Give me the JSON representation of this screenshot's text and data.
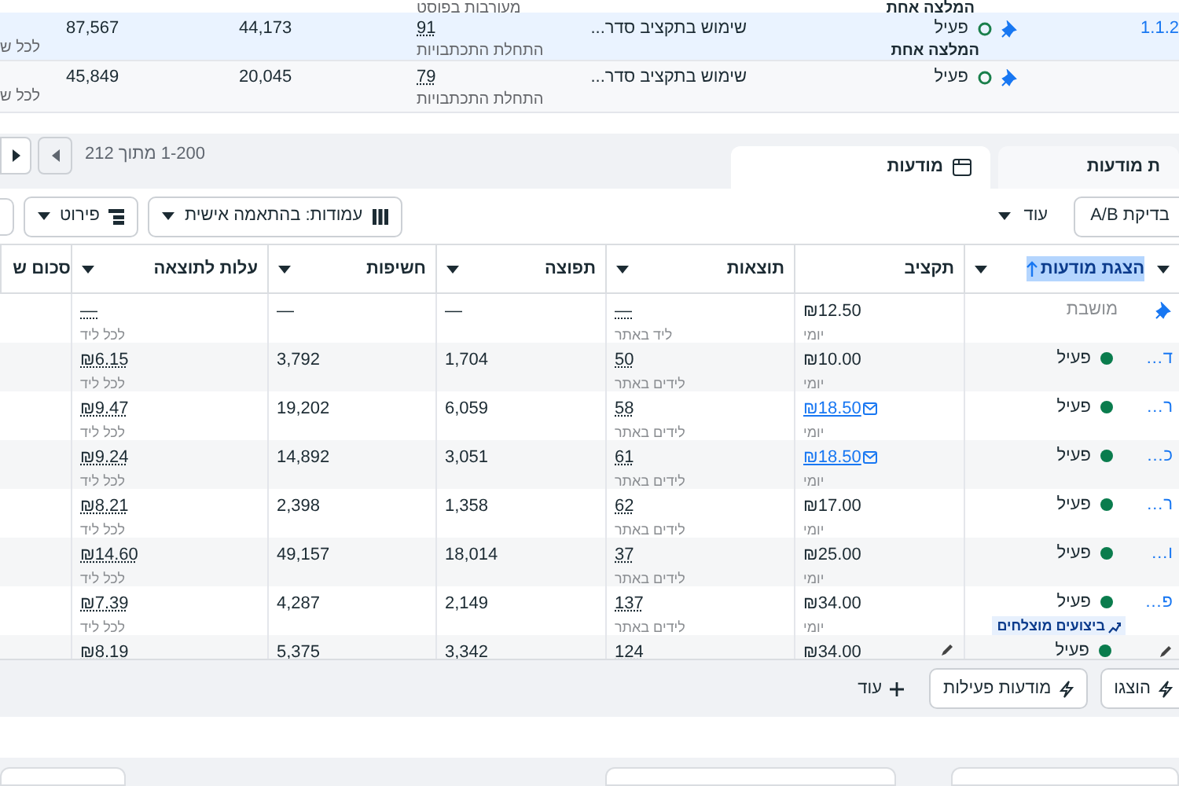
{
  "ad_sets_table": {
    "partial_row": {
      "result_type": "מעורבות בפוסט",
      "recommendation": "המלצה אחת"
    },
    "rows": [
      {
        "selected": true,
        "name": "1.1.2",
        "pinned": true,
        "status": "פעיל",
        "recommendation": "המלצה אחת",
        "budget": "שימוש בתקציב סדר...",
        "results": "91",
        "result_type": "התחלת התכתבויות",
        "column_3": "44,173",
        "column_2": "87,567",
        "column_1": "לכל ש"
      },
      {
        "selected": false,
        "pinned": true,
        "status": "פעיל",
        "budget": "שימוש בתקציב סדר...",
        "results": "79",
        "result_type": "התחלת התכתבויות",
        "column_3": "20,045",
        "column_2": "45,849",
        "column_1": "לכל ש"
      }
    ]
  },
  "pagination": {
    "range": "1-200 מתוך 212"
  },
  "tabs": [
    {
      "label": "ת מודעות",
      "selected": false
    },
    {
      "label": "מודעות",
      "selected": true
    }
  ],
  "toolbar": {
    "ab_test": "בדיקת A/B",
    "more": "עוד",
    "columns": "עמודות: בהתאמה אישית",
    "breakdown": "פירוט"
  },
  "ads_table": {
    "columns": [
      {
        "label": "הצגת מודעות",
        "sorted": true,
        "menu": true
      },
      {
        "label": "תקציב",
        "sorted": false,
        "menu": false
      },
      {
        "label": "תוצאות",
        "sorted": false,
        "menu": true
      },
      {
        "label": "תפוצה",
        "sorted": false,
        "menu": true
      },
      {
        "label": "חשיפות",
        "sorted": false,
        "menu": true
      },
      {
        "label": "עלות לתוצאה",
        "sorted": false,
        "menu": true
      },
      {
        "label": "סכום ש",
        "sorted": false,
        "menu": false
      }
    ],
    "rows": [
      {
        "pinned": true,
        "active": false,
        "hovered": false,
        "status": "מושבת",
        "budget": "₪12.50",
        "budget_period": "יומי",
        "budget_linked": false,
        "results": "—",
        "result_type": "ליד באתר",
        "reach": "—",
        "impressions": "—",
        "cost": "—",
        "cost_unit": "לכל ליד"
      },
      {
        "name": "ד…",
        "pinned": false,
        "active": true,
        "hovered": false,
        "status": "פעיל",
        "budget": "₪10.00",
        "budget_period": "יומי",
        "budget_linked": false,
        "results": "50",
        "result_type": "לידים באתר",
        "reach": "1,704",
        "impressions": "3,792",
        "cost": "₪6.15",
        "cost_unit": "לכל ליד"
      },
      {
        "name": "ר…",
        "pinned": false,
        "active": true,
        "hovered": false,
        "status": "פעיל",
        "budget": "₪18.50",
        "budget_period": "יומי",
        "budget_linked": true,
        "results": "58",
        "result_type": "לידים באתר",
        "reach": "6,059",
        "impressions": "19,202",
        "cost": "₪9.47",
        "cost_unit": "לכל ליד"
      },
      {
        "name": "כ…",
        "pinned": false,
        "active": true,
        "hovered": false,
        "status": "פעיל",
        "budget": "₪18.50",
        "budget_period": "יומי",
        "budget_linked": true,
        "results": "61",
        "result_type": "לידים באתר",
        "reach": "3,051",
        "impressions": "14,892",
        "cost": "₪9.24",
        "cost_unit": "לכל ליד"
      },
      {
        "name": "ר…",
        "pinned": false,
        "active": true,
        "hovered": false,
        "status": "פעיל",
        "budget": "₪17.00",
        "budget_period": "יומי",
        "budget_linked": false,
        "results": "62",
        "result_type": "לידים באתר",
        "reach": "1,358",
        "impressions": "2,398",
        "cost": "₪8.21",
        "cost_unit": "לכל ליד"
      },
      {
        "name": "ו…",
        "pinned": false,
        "active": true,
        "hovered": false,
        "status": "פעיל",
        "budget": "₪25.00",
        "budget_period": "יומי",
        "budget_linked": false,
        "results": "37",
        "result_type": "לידים באתר",
        "reach": "18,014",
        "impressions": "49,157",
        "cost": "₪14.60",
        "cost_unit": "לכל ליד"
      },
      {
        "name": "פ…",
        "pinned": false,
        "active": true,
        "hovered": false,
        "status": "פעיל",
        "badge": "ביצועים מוצלחים",
        "budget": "₪34.00",
        "budget_period": "יומי",
        "budget_linked": false,
        "results": "137",
        "result_type": "לידים באתר",
        "reach": "2,149",
        "impressions": "4,287",
        "cost": "₪7.39",
        "cost_unit": "לכל ליד"
      },
      {
        "pinned": false,
        "active": true,
        "hovered": true,
        "status": "פעיל",
        "budget": "₪34.00",
        "budget_linked": false,
        "results": "124",
        "reach": "3,342",
        "impressions": "5,375",
        "cost": "₪8.19"
      }
    ]
  },
  "bottom_bar": {
    "buttons": [
      {
        "label": "הוצגו",
        "kind": "lightning"
      },
      {
        "label": "מודעות פעילות",
        "kind": "lightning"
      },
      {
        "label": "עוד",
        "kind": "plus"
      }
    ]
  }
}
